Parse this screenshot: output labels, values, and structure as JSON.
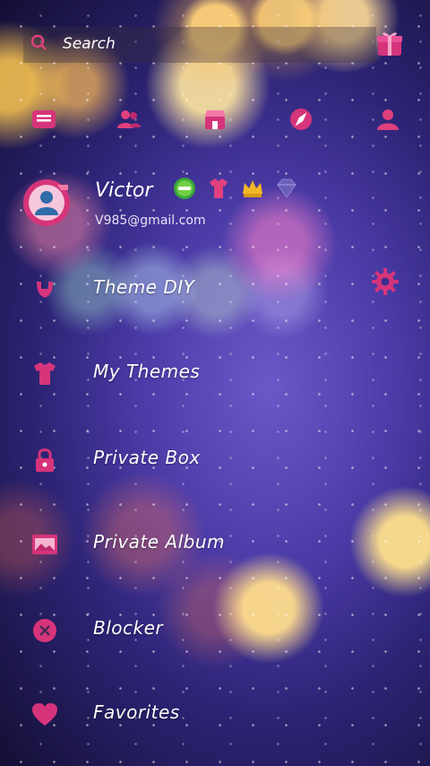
{
  "search": {
    "placeholder": "Search"
  },
  "quickbar": {
    "icons": [
      "menu-icon",
      "contacts-icon",
      "store-icon",
      "compass-icon",
      "profile-icon"
    ]
  },
  "profile": {
    "name": "Victor",
    "email": "V985@gmail.com",
    "badges": [
      "go-badge-icon",
      "shirt-icon",
      "crown-icon",
      "diamond-icon"
    ]
  },
  "menu": {
    "items": [
      {
        "label": "Theme DIY",
        "icon": "theme-diy-icon"
      },
      {
        "label": "My Themes",
        "icon": "shirt-icon"
      },
      {
        "label": "Private Box",
        "icon": "lock-icon"
      },
      {
        "label": "Private Album",
        "icon": "album-icon"
      },
      {
        "label": "Blocker",
        "icon": "block-icon"
      },
      {
        "label": "Favorites",
        "icon": "heart-icon"
      }
    ]
  },
  "colors": {
    "accent": "#e0407e",
    "background": "#3a2d8f",
    "highlight": "#ffcf6e"
  }
}
